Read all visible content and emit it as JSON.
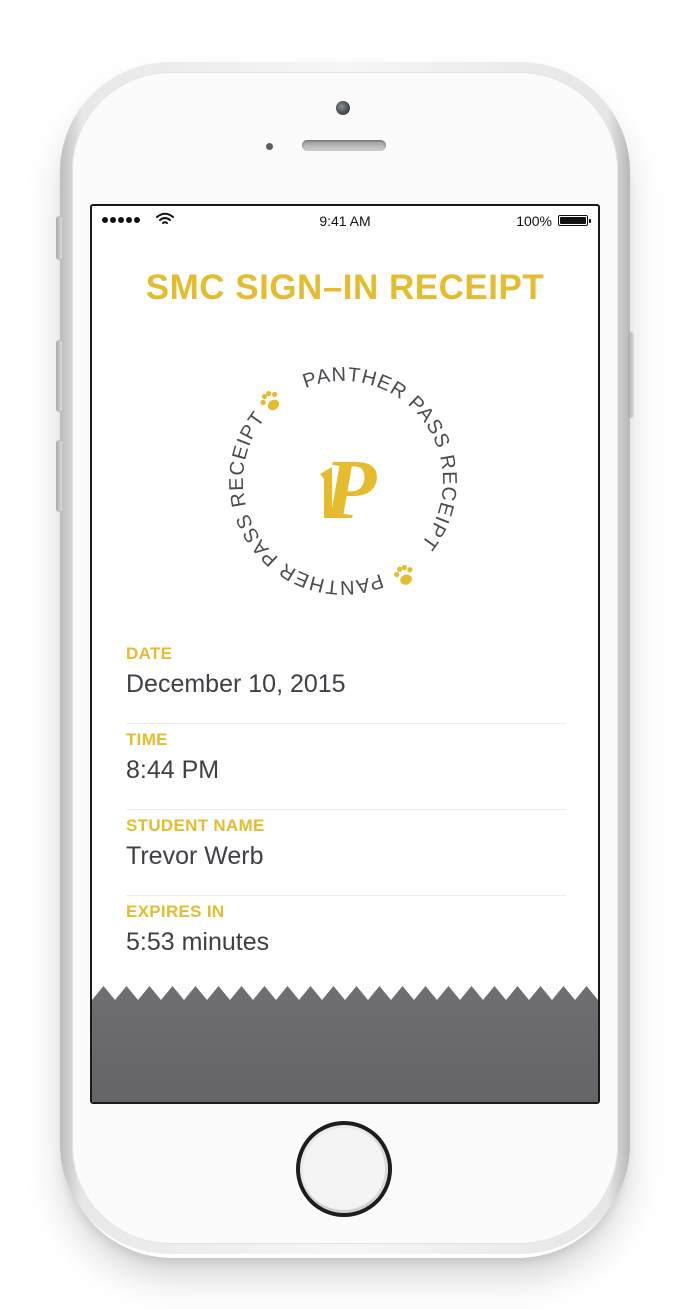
{
  "status_bar": {
    "time": "9:41 AM",
    "battery_percent": "100%",
    "signal_icon": "signal-dots-icon",
    "wifi_icon": "wifi-icon",
    "battery_icon": "battery-icon"
  },
  "receipt": {
    "title": "SMC SIGN–IN RECEIPT",
    "emblem": {
      "logo_letter": "P",
      "ring_text": "PANTHER PASS RECEIPT",
      "paw_icon": "paw-icon"
    },
    "fields": [
      {
        "label": "DATE",
        "value": "December 10, 2015"
      },
      {
        "label": "TIME",
        "value": "8:44 PM"
      },
      {
        "label": "STUDENT NAME",
        "value": "Trevor Werb"
      },
      {
        "label": "EXPIRES IN",
        "value": "5:53 minutes"
      }
    ]
  },
  "colors": {
    "accent": "#e6bc2f",
    "text": "#3f3f45",
    "footer": "#6b6a6e"
  }
}
